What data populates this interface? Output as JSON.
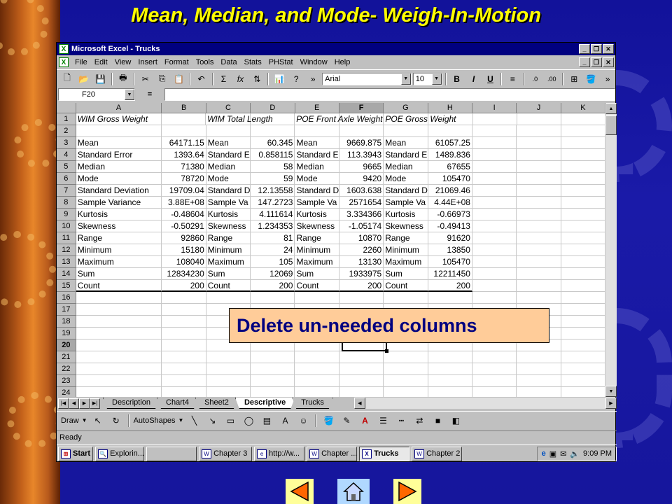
{
  "slide": {
    "title": "Mean, Median, and Mode- Weigh-In-Motion",
    "callout": "Delete un-needed columns"
  },
  "window": {
    "title": "Microsoft Excel - Trucks",
    "app_icon": "excel-icon"
  },
  "menu": [
    "File",
    "Edit",
    "View",
    "Insert",
    "Format",
    "Tools",
    "Data",
    "Stats",
    "PHStat",
    "Window",
    "Help"
  ],
  "toolbar": {
    "font_name": "Arial",
    "font_size": "10",
    "bold": "B",
    "italic": "I",
    "underline": "U",
    "sum": "Σ",
    "function": "fx"
  },
  "formula_bar": {
    "name_box": "F20",
    "equals": "="
  },
  "grid": {
    "columns": [
      "A",
      "B",
      "C",
      "D",
      "E",
      "F",
      "G",
      "H",
      "I",
      "J",
      "K"
    ],
    "active_column": "F",
    "active_row": "20",
    "header_row": [
      "WIM Gross Weight",
      "",
      "WIM Total Length",
      "",
      "POE Front Axle Weight",
      "",
      "POE Gross Weight",
      ""
    ],
    "rows": [
      {
        "n": "1",
        "cells": [
          "WIM Gross Weight",
          "",
          "WIM Total Length",
          "",
          "POE Front Axle Weight",
          "",
          "POE Gross Weight",
          ""
        ]
      },
      {
        "n": "2",
        "cells": [
          "",
          "",
          "",
          "",
          "",
          "",
          "",
          ""
        ]
      },
      {
        "n": "3",
        "cells": [
          "Mean",
          "64171.15",
          "Mean",
          "60.345",
          "Mean",
          "9669.875",
          "Mean",
          "61057.25"
        ]
      },
      {
        "n": "4",
        "cells": [
          "Standard Error",
          "1393.64",
          "Standard E",
          "0.858115",
          "Standard E",
          "113.3943",
          "Standard E",
          "1489.836"
        ]
      },
      {
        "n": "5",
        "cells": [
          "Median",
          "71380",
          "Median",
          "58",
          "Median",
          "9665",
          "Median",
          "67655"
        ]
      },
      {
        "n": "6",
        "cells": [
          "Mode",
          "78720",
          "Mode",
          "59",
          "Mode",
          "9420",
          "Mode",
          "105470"
        ]
      },
      {
        "n": "7",
        "cells": [
          "Standard Deviation",
          "19709.04",
          "Standard D",
          "12.13558",
          "Standard D",
          "1603.638",
          "Standard D",
          "21069.46"
        ]
      },
      {
        "n": "8",
        "cells": [
          "Sample Variance",
          "3.88E+08",
          "Sample Va",
          "147.2723",
          "Sample Va",
          "2571654",
          "Sample Va",
          "4.44E+08"
        ]
      },
      {
        "n": "9",
        "cells": [
          "Kurtosis",
          "-0.48604",
          "Kurtosis",
          "4.111614",
          "Kurtosis",
          "3.334366",
          "Kurtosis",
          "-0.66973"
        ]
      },
      {
        "n": "10",
        "cells": [
          "Skewness",
          "-0.50291",
          "Skewness",
          "1.234353",
          "Skewness",
          "-1.05174",
          "Skewness",
          "-0.49413"
        ]
      },
      {
        "n": "11",
        "cells": [
          "Range",
          "92860",
          "Range",
          "81",
          "Range",
          "10870",
          "Range",
          "91620"
        ]
      },
      {
        "n": "12",
        "cells": [
          "Minimum",
          "15180",
          "Minimum",
          "24",
          "Minimum",
          "2260",
          "Minimum",
          "13850"
        ]
      },
      {
        "n": "13",
        "cells": [
          "Maximum",
          "108040",
          "Maximum",
          "105",
          "Maximum",
          "13130",
          "Maximum",
          "105470"
        ]
      },
      {
        "n": "14",
        "cells": [
          "Sum",
          "12834230",
          "Sum",
          "12069",
          "Sum",
          "1933975",
          "Sum",
          "12211450"
        ]
      },
      {
        "n": "15",
        "cells": [
          "Count",
          "200",
          "Count",
          "200",
          "Count",
          "200",
          "Count",
          "200"
        ]
      },
      {
        "n": "16",
        "cells": [
          "",
          "",
          "",
          "",
          "",
          "",
          "",
          ""
        ]
      },
      {
        "n": "17",
        "cells": [
          "",
          "",
          "",
          "",
          "",
          "",
          "",
          ""
        ]
      },
      {
        "n": "18",
        "cells": [
          "",
          "",
          "",
          "",
          "",
          "",
          "",
          ""
        ]
      },
      {
        "n": "19",
        "cells": [
          "",
          "",
          "",
          "",
          "",
          "",
          "",
          ""
        ]
      },
      {
        "n": "20",
        "cells": [
          "",
          "",
          "",
          "",
          "",
          "",
          "",
          ""
        ]
      },
      {
        "n": "21",
        "cells": [
          "",
          "",
          "",
          "",
          "",
          "",
          "",
          ""
        ]
      },
      {
        "n": "22",
        "cells": [
          "",
          "",
          "",
          "",
          "",
          "",
          "",
          ""
        ]
      },
      {
        "n": "23",
        "cells": [
          "",
          "",
          "",
          "",
          "",
          "",
          "",
          ""
        ]
      },
      {
        "n": "24",
        "cells": [
          "",
          "",
          "",
          "",
          "",
          "",
          "",
          ""
        ]
      }
    ]
  },
  "sheet_tabs": [
    "Description",
    "Chart4",
    "Sheet2",
    "Descriptive",
    "Trucks"
  ],
  "active_sheet": "Descriptive",
  "drawing_toolbar": {
    "draw": "Draw",
    "autoshapes": "AutoShapes"
  },
  "status": "Ready",
  "taskbar": {
    "start": "Start",
    "items": [
      "Explorin...",
      "",
      "Chapter 3",
      "http://w...",
      "Chapter ...",
      "Trucks",
      "Chapter 2"
    ],
    "active": "Trucks",
    "clock": "9:09 PM"
  }
}
